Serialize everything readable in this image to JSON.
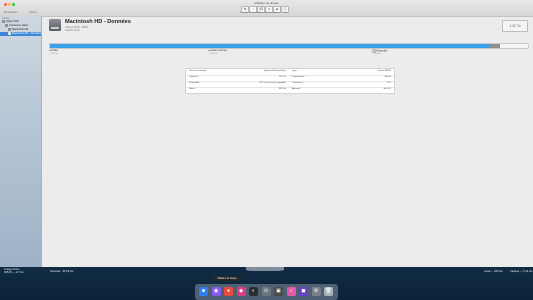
{
  "window": {
    "title": "Utilitaire de disque",
    "toolbar": {
      "labels": [
        "First Aid",
        "Partitionner",
        "Effacer",
        "Restaurer",
        "Monter",
        "Infos"
      ],
      "sidebar_label": "Présentation",
      "volume_label": "Volume"
    }
  },
  "sidebar": {
    "section": "Interne",
    "items": [
      {
        "label": "Apple SSD"
      },
      {
        "label": "Conteneur disk1"
      },
      {
        "label": "Macintosh HD"
      },
      {
        "label": "Macintosh HD - Données"
      }
    ]
  },
  "volume": {
    "name": "Macintosh HD - Données",
    "subtitle_line1": "Volume APFS · APFS",
    "subtitle_line2": "macOS 10.15",
    "capacity": "1,02 To"
  },
  "usage": {
    "used_fraction": 0.92,
    "other_fraction": 0.02,
    "used_color": "#3aa0ea",
    "other_color": "#8f8f8f",
    "legend": [
      {
        "label": "Utilisé",
        "value": "954 Go",
        "color": "#3aa0ea"
      },
      {
        "label": "Autres volumes",
        "value": "26,9 Go",
        "color": "#8f8f8f"
      },
      {
        "label": "Disponible",
        "value": "20 Go",
        "color": "#e0e0e0"
      }
    ]
  },
  "info": {
    "rows": [
      {
        "k1": "Point de montage :",
        "v1": "/System/Volumes/Data",
        "k2": "Type :",
        "v2": "Volume APFS"
      },
      {
        "k1": "Capacité :",
        "v1": "1,02 To",
        "k2": "Propriétaires :",
        "v2": "Activé"
      },
      {
        "k1": "Disponible :",
        "v1": "20,2 Go (0 octet purgeable)",
        "k2": "Connexion :",
        "v2": "PCI"
      },
      {
        "k1": "Utilisé :",
        "v1": "954 Go",
        "k2": "Appareil :",
        "v2": "disk1s2"
      }
    ]
  },
  "desktop": {
    "left_label": "Images Drive",
    "left_sub": "945,45 — 2,7 Go",
    "mid_label": "Données · 65,09 Go",
    "right_label1": "Local — 209 Go",
    "right_label2": "Capture — 5,14 Go"
  },
  "dock": {
    "tooltip": "Utilitaire de disque",
    "apps": [
      {
        "name": "finder",
        "color": "#2d7ff0",
        "glyph": "☻"
      },
      {
        "name": "launchpad",
        "color": "#8c5cf0",
        "glyph": "◉"
      },
      {
        "name": "chrome",
        "color": "#e84c3d",
        "glyph": "●"
      },
      {
        "name": "app4",
        "color": "#d64086",
        "glyph": "◆"
      },
      {
        "name": "app5",
        "color": "#2c2c2c",
        "glyph": "◐"
      },
      {
        "name": "disk-utility",
        "color": "#6c7580",
        "glyph": "⊙"
      },
      {
        "name": "app7",
        "color": "#4a4a4a",
        "glyph": "▣"
      },
      {
        "name": "app8",
        "color": "#e45aa8",
        "glyph": "♪"
      },
      {
        "name": "app9",
        "color": "#6a3fd0",
        "glyph": "◼"
      },
      {
        "name": "system-preferences",
        "color": "#7a808a",
        "glyph": "⚙"
      },
      {
        "name": "trash",
        "color": "#a8b3bd",
        "glyph": "🗑"
      }
    ]
  }
}
